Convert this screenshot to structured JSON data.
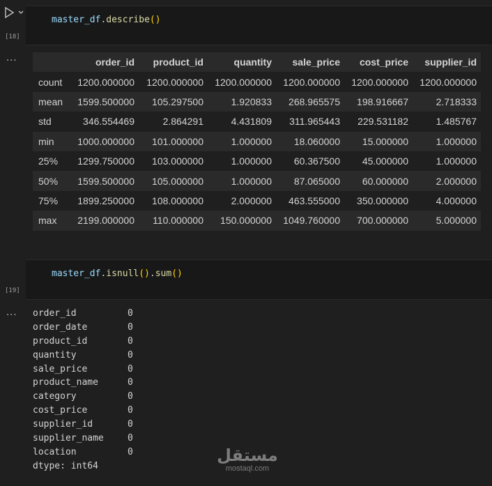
{
  "cells": [
    {
      "exec_count": "[18]",
      "code": {
        "var": "master_df",
        "dot": ".",
        "method": "describe",
        "open": "(",
        "close": ")"
      },
      "output": {
        "columns": [
          "order_id",
          "product_id",
          "quantity",
          "sale_price",
          "cost_price",
          "supplier_id"
        ],
        "rows": [
          {
            "index": "count",
            "values": [
              "1200.000000",
              "1200.000000",
              "1200.000000",
              "1200.000000",
              "1200.000000",
              "1200.000000"
            ]
          },
          {
            "index": "mean",
            "values": [
              "1599.500000",
              "105.297500",
              "1.920833",
              "268.965575",
              "198.916667",
              "2.718333"
            ]
          },
          {
            "index": "std",
            "values": [
              "346.554469",
              "2.864291",
              "4.431809",
              "311.965443",
              "229.531182",
              "1.485767"
            ]
          },
          {
            "index": "min",
            "values": [
              "1000.000000",
              "101.000000",
              "1.000000",
              "18.060000",
              "15.000000",
              "1.000000"
            ]
          },
          {
            "index": "25%",
            "values": [
              "1299.750000",
              "103.000000",
              "1.000000",
              "60.367500",
              "45.000000",
              "1.000000"
            ]
          },
          {
            "index": "50%",
            "values": [
              "1599.500000",
              "105.000000",
              "1.000000",
              "87.065000",
              "60.000000",
              "2.000000"
            ]
          },
          {
            "index": "75%",
            "values": [
              "1899.250000",
              "108.000000",
              "2.000000",
              "463.555000",
              "350.000000",
              "4.000000"
            ]
          },
          {
            "index": "max",
            "values": [
              "2199.000000",
              "110.000000",
              "150.000000",
              "1049.760000",
              "700.000000",
              "5.000000"
            ]
          }
        ]
      }
    },
    {
      "exec_count": "[19]",
      "code": {
        "var": "master_df",
        "dot": ".",
        "method1": "isnull",
        "method2": "sum",
        "open": "(",
        "close": ")",
        "dot2": "."
      },
      "output": {
        "rows": [
          {
            "key": "order_id",
            "value": "0"
          },
          {
            "key": "order_date",
            "value": "0"
          },
          {
            "key": "product_id",
            "value": "0"
          },
          {
            "key": "quantity",
            "value": "0"
          },
          {
            "key": "sale_price",
            "value": "0"
          },
          {
            "key": "product_name",
            "value": "0"
          },
          {
            "key": "category",
            "value": "0"
          },
          {
            "key": "cost_price",
            "value": "0"
          },
          {
            "key": "supplier_id",
            "value": "0"
          },
          {
            "key": "supplier_name",
            "value": "0"
          },
          {
            "key": "location",
            "value": "0"
          }
        ],
        "dtype": "dtype: int64"
      }
    }
  ],
  "more_icon": "...",
  "icons": {
    "run": "play-icon",
    "run_menu": "chevron-down-icon",
    "output_menu": "ellipsis-icon"
  },
  "watermark": {
    "arabic": "مستقل",
    "latin": "mostaql.com"
  }
}
